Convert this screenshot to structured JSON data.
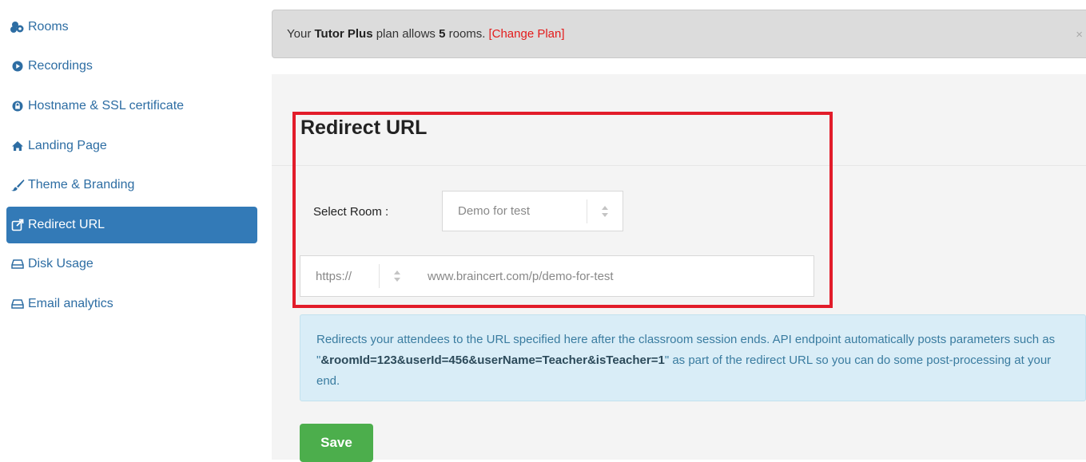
{
  "sidebar": {
    "items": [
      {
        "label": "Rooms",
        "icon": "rooms-icon"
      },
      {
        "label": "Recordings",
        "icon": "play-circle-icon"
      },
      {
        "label": "Hostname & SSL certificate",
        "icon": "lock-icon"
      },
      {
        "label": "Landing Page",
        "icon": "home-icon"
      },
      {
        "label": "Theme & Branding",
        "icon": "brush-icon"
      },
      {
        "label": "Redirect URL",
        "icon": "external-link-icon",
        "active": true
      },
      {
        "label": "Disk Usage",
        "icon": "hdd-icon"
      },
      {
        "label": "Email analytics",
        "icon": "hdd-icon"
      }
    ]
  },
  "alert": {
    "prefix": "Your",
    "plan": "Tutor Plus",
    "middle": "plan allows",
    "count": "5",
    "suffix": "rooms.",
    "change_plan": "[Change Plan]",
    "close": "×"
  },
  "main": {
    "heading": "Redirect URL",
    "select_room_label": "Select Room :",
    "select_room_value": "Demo for test",
    "protocol_value": "https://",
    "url_placeholder": "www.braincert.com/p/demo-for-test",
    "info_pre": "Redirects your attendees to the URL specified here after the classroom session ends. API endpoint automatically posts parameters such as \"",
    "info_params": "&roomId=123&userId=456&userName=Teacher&isTeacher=1",
    "info_post": "\" as part of the redirect URL so you can do some post-processing at your end.",
    "save_label": "Save"
  },
  "colors": {
    "accent": "#337ab7",
    "highlight": "#e21c2a",
    "save": "#4cae4c",
    "info_bg": "#d9edf7"
  }
}
